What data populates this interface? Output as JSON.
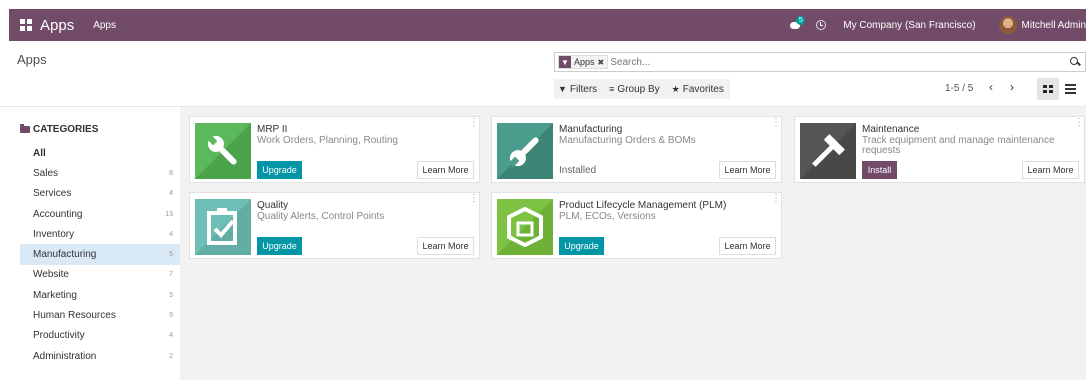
{
  "navbar": {
    "brand": "Apps",
    "menu": "Apps",
    "message_count": "5",
    "company": "My Company (San Francisco)",
    "user": "Mitchell Admin"
  },
  "control": {
    "title": "Apps",
    "facet_label": "Apps",
    "search_placeholder": "Search...",
    "filters": "Filters",
    "group_by": "Group By",
    "favorites": "Favorites",
    "pager": "1-5 / 5"
  },
  "sidebar": {
    "header": "CATEGORIES",
    "items": [
      {
        "label": "All",
        "count": ""
      },
      {
        "label": "Sales",
        "count": "8"
      },
      {
        "label": "Services",
        "count": "4"
      },
      {
        "label": "Accounting",
        "count": "13"
      },
      {
        "label": "Inventory",
        "count": "4"
      },
      {
        "label": "Manufacturing",
        "count": "5"
      },
      {
        "label": "Website",
        "count": "7"
      },
      {
        "label": "Marketing",
        "count": "5"
      },
      {
        "label": "Human Resources",
        "count": "9"
      },
      {
        "label": "Productivity",
        "count": "4"
      },
      {
        "label": "Administration",
        "count": "2"
      }
    ],
    "active_index": 5
  },
  "apps": [
    {
      "name": "MRP II",
      "summary": "Work Orders, Planning, Routing",
      "action": "Upgrade",
      "learn": "Learn More",
      "icon": "wrench-icon",
      "color": "#5cb85c"
    },
    {
      "name": "Manufacturing",
      "summary": "Manufacturing Orders & BOMs",
      "status": "Installed",
      "learn": "Learn More",
      "icon": "wrench-icon",
      "color": "#4a9c8c"
    },
    {
      "name": "Maintenance",
      "summary": "Track equipment and manage maintenance requests",
      "action": "Install",
      "learn": "Learn More",
      "icon": "hammer-icon",
      "color": "#555555"
    },
    {
      "name": "Quality",
      "summary": "Quality Alerts, Control Points",
      "action": "Upgrade",
      "learn": "Learn More",
      "icon": "clipboard-check-icon",
      "color": "#6fbfb6"
    },
    {
      "name": "Product Lifecycle Management (PLM)",
      "summary": "PLM, ECOs, Versions",
      "action": "Upgrade",
      "learn": "Learn More",
      "icon": "box-icon",
      "color": "#7dc242"
    }
  ],
  "colors": {
    "brand": "#714B67",
    "upgrade": "#0096a6",
    "active_category": "#d9e9f6"
  }
}
